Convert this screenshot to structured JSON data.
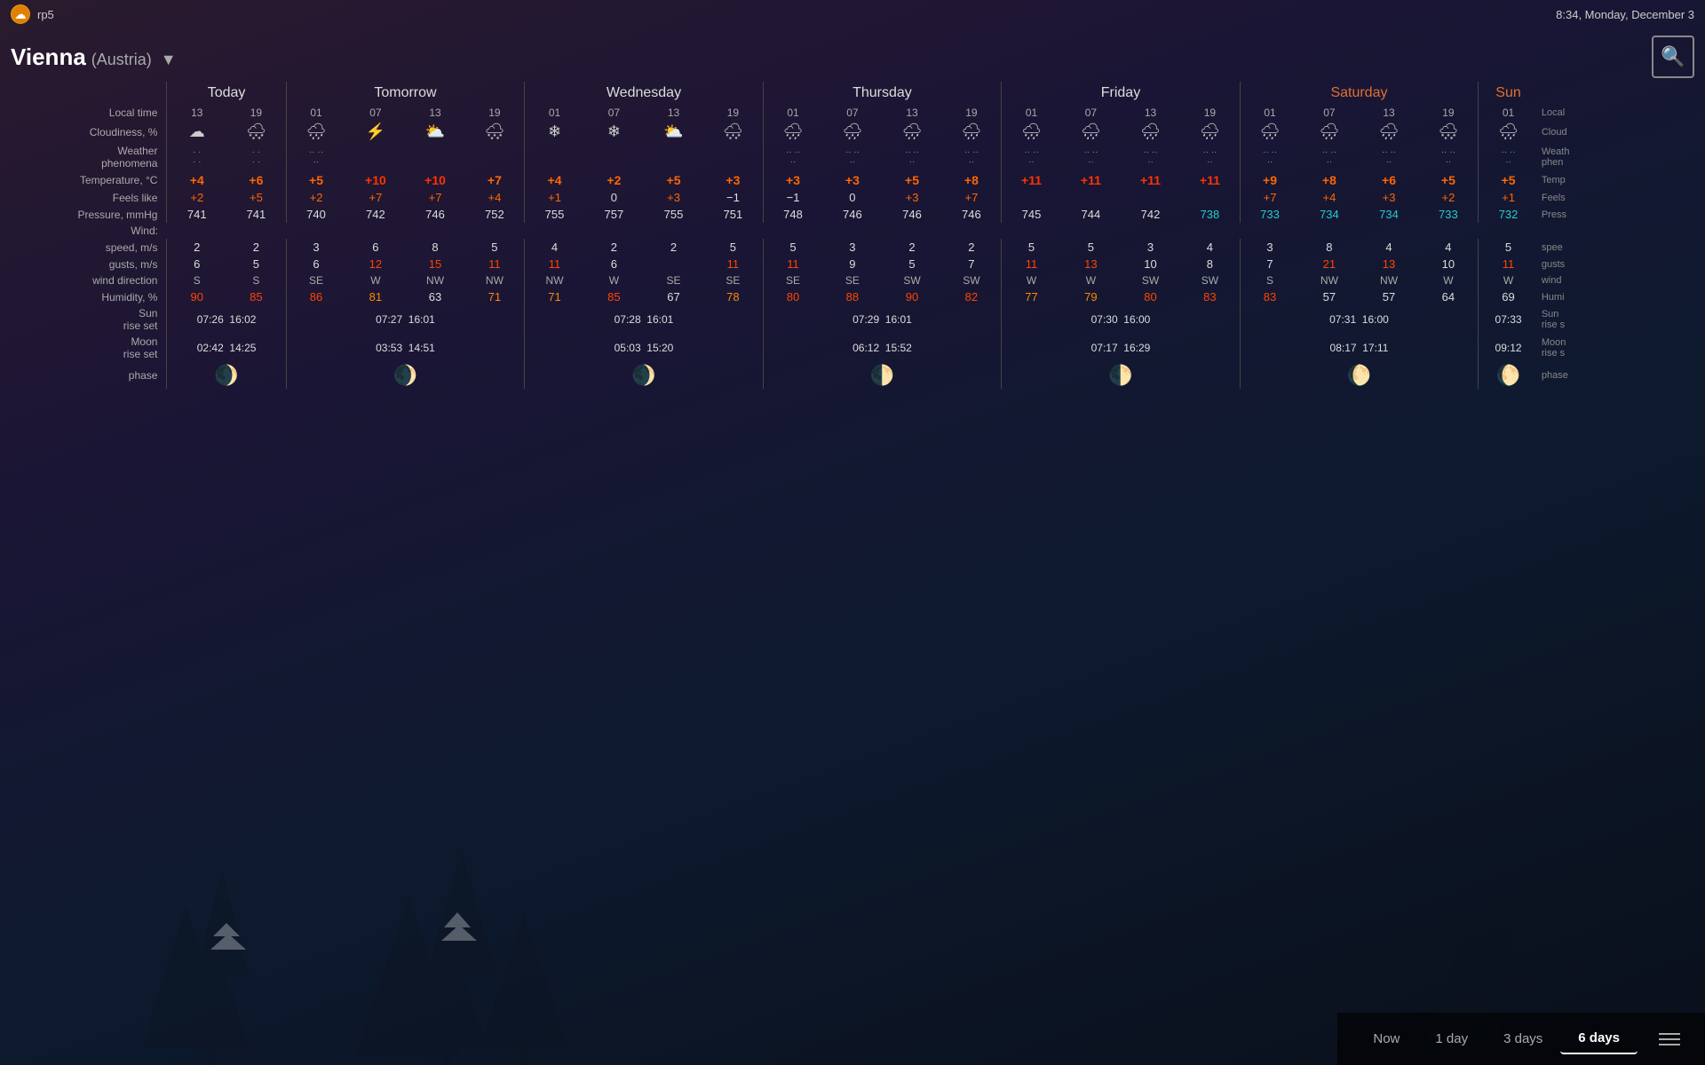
{
  "app": {
    "title": "rp5",
    "datetime": "8:34, Monday, December 3"
  },
  "location": {
    "city": "Vienna",
    "country": "(Austria)",
    "dropdown_icon": "▼"
  },
  "table": {
    "days": [
      {
        "label": "Today",
        "is_weekend": false
      },
      {
        "label": "Tomorrow",
        "is_weekend": false
      },
      {
        "label": "Wednesday",
        "is_weekend": false
      },
      {
        "label": "Thursday",
        "is_weekend": false
      },
      {
        "label": "Friday",
        "is_weekend": false
      },
      {
        "label": "Saturday",
        "is_weekend": true
      },
      {
        "label": "Sun",
        "is_weekend": true
      }
    ],
    "row_labels": {
      "local_time": "Local time",
      "cloudiness": "Cloudiness, %",
      "weather_phenomena": "Weather phenomena",
      "temperature": "Temperature, °C",
      "feels_like": "Feels like",
      "pressure": "Pressure, mmHg",
      "wind_speed": "speed, m/s",
      "wind_gusts": "gusts, m/s",
      "wind_direction": "wind direction",
      "wind_section": "Wind:",
      "humidity": "Humidity, %",
      "sun_rise_set": "Sun rise set",
      "moon_rise_set": "Moon rise set",
      "moon_phase": "phase"
    },
    "columns": [
      {
        "day": 0,
        "time": "13",
        "cloudiness": "☁",
        "temp": "+4",
        "temp_class": "temp-orange",
        "feels": "+2",
        "feels_class": "temp-orange",
        "pressure": "741",
        "pressure_class": "pressure-normal",
        "wind_speed": "2",
        "wind_speed_class": "wind-white",
        "wind_gusts": "6",
        "wind_gusts_class": "wind-white",
        "wind_dir": "S",
        "humidity": "90",
        "humidity_class": "humidity-red"
      },
      {
        "day": 0,
        "time": "19",
        "cloudiness": "🌨",
        "temp": "+6",
        "temp_class": "temp-orange",
        "feels": "+5",
        "feels_class": "temp-orange",
        "pressure": "741",
        "pressure_class": "pressure-normal",
        "wind_speed": "2",
        "wind_speed_class": "wind-white",
        "wind_gusts": "5",
        "wind_gusts_class": "wind-white",
        "wind_dir": "S",
        "humidity": "85",
        "humidity_class": "humidity-red"
      },
      {
        "day": 1,
        "time": "01",
        "cloudiness": "🌧",
        "temp": "+5",
        "temp_class": "temp-orange",
        "feels": "+2",
        "feels_class": "temp-orange",
        "pressure": "740",
        "pressure_class": "pressure-normal",
        "wind_speed": "3",
        "wind_speed_class": "wind-white",
        "wind_gusts": "6",
        "wind_gusts_class": "wind-white",
        "wind_dir": "SE",
        "humidity": "86",
        "humidity_class": "humidity-red"
      },
      {
        "day": 1,
        "time": "07",
        "cloudiness": "🌩",
        "temp": "+10",
        "temp_class": "temp-red",
        "feels": "+7",
        "feels_class": "temp-orange",
        "pressure": "742",
        "pressure_class": "pressure-normal",
        "wind_speed": "6",
        "wind_speed_class": "wind-white",
        "wind_gusts": "12",
        "wind_gusts_class": "wind-red",
        "wind_dir": "W",
        "humidity": "81",
        "humidity_class": "humidity-orange"
      },
      {
        "day": 1,
        "time": "13",
        "cloudiness": "⛅",
        "temp": "+10",
        "temp_class": "temp-red",
        "feels": "+7",
        "feels_class": "temp-orange",
        "pressure": "746",
        "pressure_class": "pressure-normal",
        "wind_speed": "8",
        "wind_speed_class": "wind-white",
        "wind_gusts": "15",
        "wind_gusts_class": "wind-red",
        "wind_dir": "NW",
        "humidity": "63",
        "humidity_class": "humidity-white"
      },
      {
        "day": 1,
        "time": "19",
        "cloudiness": "🌨",
        "temp": "+7",
        "temp_class": "temp-orange",
        "feels": "+4",
        "feels_class": "temp-orange",
        "pressure": "752",
        "pressure_class": "pressure-normal",
        "wind_speed": "5",
        "wind_speed_class": "wind-white",
        "wind_gusts": "11",
        "wind_gusts_class": "wind-red",
        "wind_dir": "NW",
        "humidity": "71",
        "humidity_class": "humidity-white"
      },
      {
        "day": 2,
        "time": "01",
        "cloudiness": "❄",
        "temp": "+4",
        "temp_class": "temp-orange",
        "feels": "+1",
        "feels_class": "temp-orange",
        "pressure": "755",
        "pressure_class": "pressure-normal",
        "wind_speed": "4",
        "wind_speed_class": "wind-white",
        "wind_gusts": "11",
        "wind_gusts_class": "wind-red",
        "wind_dir": "NW",
        "humidity": "71",
        "humidity_class": "humidity-white"
      },
      {
        "day": 2,
        "time": "07",
        "cloudiness": "❄",
        "temp": "+2",
        "temp_class": "temp-orange",
        "feels": "0",
        "feels_class": "temp-white",
        "pressure": "757",
        "pressure_class": "pressure-normal",
        "wind_speed": "2",
        "wind_speed_class": "wind-white",
        "wind_gusts": "6",
        "wind_gusts_class": "wind-white",
        "wind_dir": "W",
        "humidity": "85",
        "humidity_class": "humidity-red"
      },
      {
        "day": 2,
        "time": "13",
        "cloudiness": "⛅",
        "temp": "+5",
        "temp_class": "temp-orange",
        "feels": "+3",
        "feels_class": "temp-orange",
        "pressure": "755",
        "pressure_class": "pressure-normal",
        "wind_speed": "2",
        "wind_speed_class": "wind-white",
        "wind_gusts": "",
        "wind_gusts_class": "wind-white",
        "wind_dir": "SE",
        "humidity": "67",
        "humidity_class": "humidity-white"
      },
      {
        "day": 2,
        "time": "19",
        "cloudiness": "🌨",
        "temp": "+3",
        "temp_class": "temp-orange",
        "feels": "−1",
        "feels_class": "temp-white",
        "pressure": "751",
        "pressure_class": "pressure-normal",
        "wind_speed": "5",
        "wind_speed_class": "wind-white",
        "wind_gusts": "11",
        "wind_gusts_class": "wind-red",
        "wind_dir": "SE",
        "humidity": "78",
        "humidity_class": "humidity-orange"
      },
      {
        "day": 3,
        "time": "01",
        "cloudiness": "🌧",
        "temp": "+3",
        "temp_class": "temp-orange",
        "feels": "−1",
        "feels_class": "temp-white",
        "pressure": "748",
        "pressure_class": "pressure-normal",
        "wind_speed": "5",
        "wind_speed_class": "wind-white",
        "wind_gusts": "11",
        "wind_gusts_class": "wind-red",
        "wind_dir": "SE",
        "humidity": "80",
        "humidity_class": "humidity-red"
      },
      {
        "day": 3,
        "time": "07",
        "cloudiness": "🌧",
        "temp": "+3",
        "temp_class": "temp-orange",
        "feels": "0",
        "feels_class": "temp-white",
        "pressure": "746",
        "pressure_class": "pressure-normal",
        "wind_speed": "3",
        "wind_speed_class": "wind-white",
        "wind_gusts": "9",
        "wind_gusts_class": "wind-white",
        "wind_dir": "SE",
        "humidity": "88",
        "humidity_class": "humidity-red"
      },
      {
        "day": 3,
        "time": "13",
        "cloudiness": "🌧",
        "temp": "+5",
        "temp_class": "temp-orange",
        "feels": "+3",
        "feels_class": "temp-orange",
        "pressure": "746",
        "pressure_class": "pressure-normal",
        "wind_speed": "2",
        "wind_speed_class": "wind-white",
        "wind_gusts": "5",
        "wind_gusts_class": "wind-white",
        "wind_dir": "SW",
        "humidity": "90",
        "humidity_class": "humidity-red"
      },
      {
        "day": 3,
        "time": "19",
        "cloudiness": "🌧",
        "temp": "+8",
        "temp_class": "temp-orange",
        "feels": "+7",
        "feels_class": "temp-orange",
        "pressure": "746",
        "pressure_class": "pressure-normal",
        "wind_speed": "2",
        "wind_speed_class": "wind-white",
        "wind_gusts": "7",
        "wind_gusts_class": "wind-white",
        "wind_dir": "SW",
        "humidity": "82",
        "humidity_class": "humidity-red"
      },
      {
        "day": 4,
        "time": "01",
        "cloudiness": "🌧",
        "temp": "+11",
        "temp_class": "temp-red",
        "feels": "",
        "feels_class": "temp-white",
        "pressure": "745",
        "pressure_class": "pressure-normal",
        "wind_speed": "5",
        "wind_speed_class": "wind-white",
        "wind_gusts": "11",
        "wind_gusts_class": "wind-red",
        "wind_dir": "W",
        "humidity": "77",
        "humidity_class": "humidity-orange"
      },
      {
        "day": 4,
        "time": "07",
        "cloudiness": "🌧",
        "temp": "+11",
        "temp_class": "temp-red",
        "feels": "",
        "feels_class": "temp-white",
        "pressure": "744",
        "pressure_class": "pressure-normal",
        "wind_speed": "5",
        "wind_speed_class": "wind-white",
        "wind_gusts": "13",
        "wind_gusts_class": "wind-red",
        "wind_dir": "W",
        "humidity": "79",
        "humidity_class": "humidity-orange"
      },
      {
        "day": 4,
        "time": "13",
        "cloudiness": "🌧",
        "temp": "+11",
        "temp_class": "temp-red",
        "feels": "",
        "feels_class": "temp-white",
        "pressure": "742",
        "pressure_class": "pressure-normal",
        "wind_speed": "3",
        "wind_speed_class": "wind-white",
        "wind_gusts": "10",
        "wind_gusts_class": "wind-white",
        "wind_dir": "SW",
        "humidity": "80",
        "humidity_class": "humidity-red"
      },
      {
        "day": 4,
        "time": "19",
        "cloudiness": "🌧",
        "temp": "+11",
        "temp_class": "temp-red",
        "feels": "",
        "feels_class": "temp-white",
        "pressure": "738",
        "pressure_class": "pressure-cyan",
        "wind_speed": "4",
        "wind_speed_class": "wind-white",
        "wind_gusts": "8",
        "wind_gusts_class": "wind-white",
        "wind_dir": "SW",
        "humidity": "83",
        "humidity_class": "humidity-red"
      },
      {
        "day": 5,
        "time": "01",
        "cloudiness": "🌧",
        "temp": "+9",
        "temp_class": "temp-orange",
        "feels": "+7",
        "feels_class": "temp-orange",
        "pressure": "733",
        "pressure_class": "pressure-cyan",
        "wind_speed": "3",
        "wind_speed_class": "wind-white",
        "wind_gusts": "7",
        "wind_gusts_class": "wind-white",
        "wind_dir": "S",
        "humidity": "83",
        "humidity_class": "humidity-red"
      },
      {
        "day": 5,
        "time": "07",
        "cloudiness": "🌧",
        "temp": "+8",
        "temp_class": "temp-orange",
        "feels": "+4",
        "feels_class": "temp-orange",
        "pressure": "734",
        "pressure_class": "pressure-cyan",
        "wind_speed": "8",
        "wind_speed_class": "wind-white",
        "wind_gusts": "21",
        "wind_gusts_class": "wind-red",
        "wind_dir": "NW",
        "humidity": "57",
        "humidity_class": "humidity-white"
      },
      {
        "day": 5,
        "time": "13",
        "cloudiness": "🌧",
        "temp": "+6",
        "temp_class": "temp-orange",
        "feels": "+3",
        "feels_class": "temp-orange",
        "pressure": "734",
        "pressure_class": "pressure-cyan",
        "wind_speed": "4",
        "wind_speed_class": "wind-white",
        "wind_gusts": "13",
        "wind_gusts_class": "wind-red",
        "wind_dir": "NW",
        "humidity": "57",
        "humidity_class": "humidity-white"
      },
      {
        "day": 5,
        "time": "19",
        "cloudiness": "🌨",
        "temp": "+5",
        "temp_class": "temp-orange",
        "feels": "+2",
        "feels_class": "temp-orange",
        "pressure": "733",
        "pressure_class": "pressure-cyan",
        "wind_speed": "4",
        "wind_speed_class": "wind-white",
        "wind_gusts": "10",
        "wind_gusts_class": "wind-white",
        "wind_dir": "W",
        "humidity": "64",
        "humidity_class": "humidity-white"
      },
      {
        "day": 6,
        "time": "01",
        "cloudiness": "🌧",
        "temp": "+5",
        "temp_class": "temp-orange",
        "feels": "+1",
        "feels_class": "temp-orange",
        "pressure": "732",
        "pressure_class": "pressure-cyan",
        "wind_speed": "5",
        "wind_speed_class": "wind-white",
        "wind_gusts": "11",
        "wind_gusts_class": "wind-red",
        "wind_dir": "W",
        "humidity": "69",
        "humidity_class": "humidity-white"
      }
    ],
    "sun_data": [
      {
        "day": 0,
        "rise": "07:26",
        "set": "16:02"
      },
      {
        "day": 1,
        "rise": "07:27",
        "set": "16:01"
      },
      {
        "day": 2,
        "rise": "07:28",
        "set": "16:01"
      },
      {
        "day": 3,
        "rise": "07:29",
        "set": "16:01"
      },
      {
        "day": 4,
        "rise": "07:30",
        "set": "16:00"
      },
      {
        "day": 5,
        "rise": "07:31",
        "set": "16:00"
      },
      {
        "day": 6,
        "rise": "07:33",
        "set": ""
      }
    ],
    "moon_data": [
      {
        "day": 0,
        "rise": "02:42",
        "set": "14:25",
        "phase": "🌒"
      },
      {
        "day": 1,
        "rise": "03:53",
        "set": "14:51",
        "phase": "🌒"
      },
      {
        "day": 2,
        "rise": "05:03",
        "set": "15:20",
        "phase": "🌒"
      },
      {
        "day": 3,
        "rise": "06:12",
        "set": "15:52",
        "phase": "🌓"
      },
      {
        "day": 4,
        "rise": "07:17",
        "set": "16:29",
        "phase": "🌓"
      },
      {
        "day": 5,
        "rise": "08:17",
        "set": "17:11",
        "phase": "🌔"
      },
      {
        "day": 6,
        "rise": "09:12",
        "set": "",
        "phase": "🌔"
      }
    ]
  },
  "bottom_nav": {
    "now": "Now",
    "one_day": "1 day",
    "three_days": "3 days",
    "six_days": "6 days",
    "active": "6 days"
  }
}
